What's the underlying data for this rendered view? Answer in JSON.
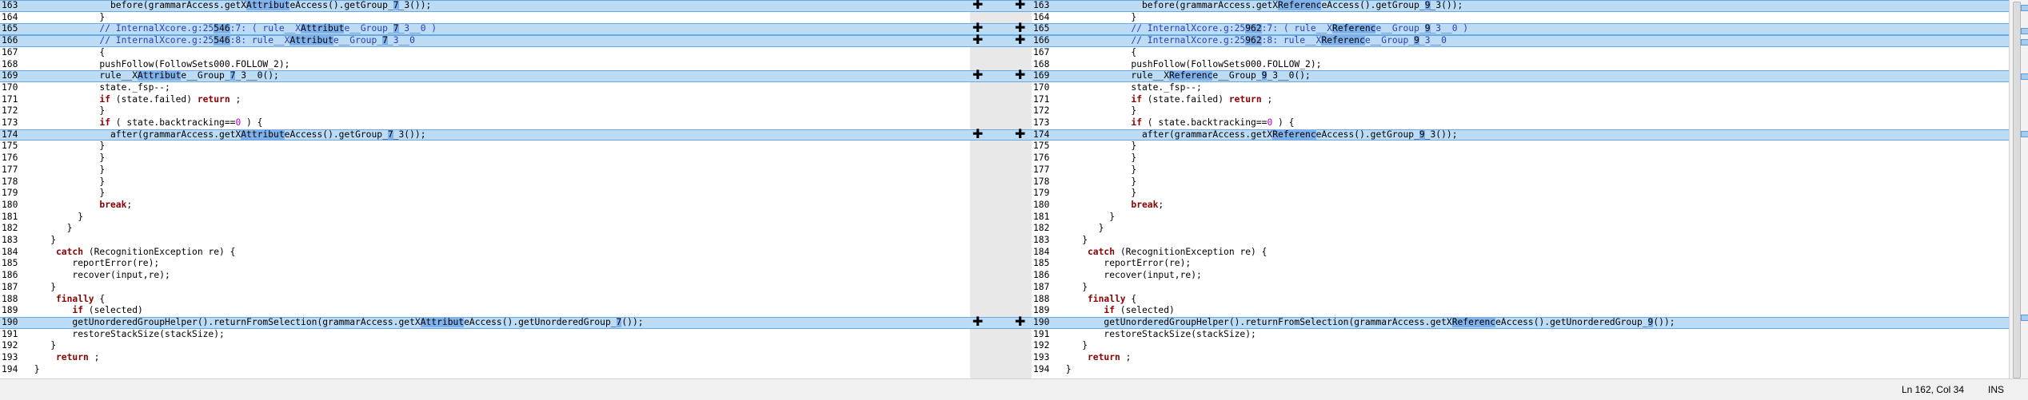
{
  "status_bar": {
    "position": "Ln 162, Col 34",
    "mode": "INS"
  },
  "left_pane": {
    "lines": [
      {
        "n": "163",
        "changed": true,
        "indent": 15,
        "segs": [
          [
            "p",
            "before(grammarAccess.getX"
          ],
          [
            "h",
            "Attribut"
          ],
          [
            "p",
            "eAccess().getGroup_"
          ],
          [
            "h",
            "7"
          ],
          [
            "p",
            "_3());"
          ]
        ]
      },
      {
        "n": "164",
        "changed": false,
        "indent": 13,
        "segs": [
          [
            "p",
            "}"
          ]
        ]
      },
      {
        "n": "165",
        "changed": true,
        "indent": 13,
        "segs": [
          [
            "c",
            "// InternalXcore.g:25"
          ],
          [
            "h",
            "546"
          ],
          [
            "c",
            ":7: ( rule__X"
          ],
          [
            "h",
            "Attribut"
          ],
          [
            "c",
            "e__Group_"
          ],
          [
            "h",
            "7"
          ],
          [
            "c",
            "_3__0 )"
          ]
        ]
      },
      {
        "n": "166",
        "changed": true,
        "indent": 13,
        "segs": [
          [
            "c",
            "// InternalXcore.g:25"
          ],
          [
            "h",
            "546"
          ],
          [
            "c",
            ":8: rule__X"
          ],
          [
            "h",
            "Attribut"
          ],
          [
            "c",
            "e__Group_"
          ],
          [
            "h",
            "7"
          ],
          [
            "c",
            "_3__0"
          ]
        ]
      },
      {
        "n": "167",
        "changed": false,
        "indent": 13,
        "segs": [
          [
            "p",
            "{"
          ]
        ]
      },
      {
        "n": "168",
        "changed": false,
        "indent": 13,
        "segs": [
          [
            "p",
            "pushFollow(FollowSets000.FOLLOW_2);"
          ]
        ]
      },
      {
        "n": "169",
        "changed": true,
        "indent": 13,
        "segs": [
          [
            "p",
            "rule__X"
          ],
          [
            "h",
            "Attribut"
          ],
          [
            "p",
            "e__Group_"
          ],
          [
            "h",
            "7"
          ],
          [
            "p",
            "_3__0();"
          ]
        ]
      },
      {
        "n": "170",
        "changed": false,
        "indent": 13,
        "segs": [
          [
            "p",
            "state._fsp--;"
          ]
        ]
      },
      {
        "n": "171",
        "changed": false,
        "indent": 13,
        "segs": [
          [
            "k",
            "if"
          ],
          [
            "p",
            " (state.failed) "
          ],
          [
            "k",
            "return"
          ],
          [
            "p",
            " ;"
          ]
        ]
      },
      {
        "n": "172",
        "changed": false,
        "indent": 13,
        "segs": [
          [
            "p",
            "}"
          ]
        ]
      },
      {
        "n": "173",
        "changed": false,
        "indent": 13,
        "segs": [
          [
            "k",
            "if"
          ],
          [
            "p",
            " ( state.backtracking=="
          ],
          [
            "n",
            "0"
          ],
          [
            "p",
            " ) {"
          ]
        ]
      },
      {
        "n": "174",
        "changed": true,
        "indent": 15,
        "segs": [
          [
            "p",
            "after(grammarAccess.getX"
          ],
          [
            "h",
            "Attribut"
          ],
          [
            "p",
            "eAccess().getGroup_"
          ],
          [
            "h",
            "7"
          ],
          [
            "p",
            "_3());"
          ]
        ]
      },
      {
        "n": "175",
        "changed": false,
        "indent": 13,
        "segs": [
          [
            "p",
            "}"
          ]
        ]
      },
      {
        "n": "176",
        "changed": false,
        "indent": 13,
        "segs": [
          [
            "p",
            "}"
          ]
        ]
      },
      {
        "n": "177",
        "changed": false,
        "indent": 13,
        "segs": [
          [
            "p",
            "}"
          ]
        ]
      },
      {
        "n": "178",
        "changed": false,
        "indent": 13,
        "segs": [
          [
            "p",
            "}"
          ]
        ]
      },
      {
        "n": "179",
        "changed": false,
        "indent": 13,
        "segs": [
          [
            "p",
            "}"
          ]
        ]
      },
      {
        "n": "180",
        "changed": false,
        "indent": 13,
        "segs": [
          [
            "k",
            "break"
          ],
          [
            "p",
            ";"
          ]
        ]
      },
      {
        "n": "181",
        "changed": false,
        "indent": 9,
        "segs": [
          [
            "p",
            "}"
          ]
        ]
      },
      {
        "n": "182",
        "changed": false,
        "indent": 7,
        "segs": [
          [
            "p",
            "}"
          ]
        ]
      },
      {
        "n": "183",
        "changed": false,
        "indent": 4,
        "segs": [
          [
            "p",
            "}"
          ]
        ]
      },
      {
        "n": "184",
        "changed": false,
        "indent": 5,
        "segs": [
          [
            "k",
            "catch"
          ],
          [
            "p",
            " (RecognitionException re) {"
          ]
        ]
      },
      {
        "n": "185",
        "changed": false,
        "indent": 8,
        "segs": [
          [
            "p",
            "reportError(re);"
          ]
        ]
      },
      {
        "n": "186",
        "changed": false,
        "indent": 8,
        "segs": [
          [
            "p",
            "recover(input,re);"
          ]
        ]
      },
      {
        "n": "187",
        "changed": false,
        "indent": 4,
        "segs": [
          [
            "p",
            "}"
          ]
        ]
      },
      {
        "n": "188",
        "changed": false,
        "indent": 5,
        "segs": [
          [
            "k",
            "finally"
          ],
          [
            "p",
            " {"
          ]
        ]
      },
      {
        "n": "189",
        "changed": false,
        "indent": 8,
        "segs": [
          [
            "k",
            "if"
          ],
          [
            "p",
            " (selected)"
          ]
        ]
      },
      {
        "n": "190",
        "changed": true,
        "indent": 8,
        "segs": [
          [
            "p",
            "getUnorderedGroupHelper().returnFromSelection(grammarAccess.getX"
          ],
          [
            "h",
            "Attribut"
          ],
          [
            "p",
            "eAccess().getUnorderedGroup_"
          ],
          [
            "h",
            "7"
          ],
          [
            "p",
            "());"
          ]
        ]
      },
      {
        "n": "191",
        "changed": false,
        "indent": 8,
        "segs": [
          [
            "p",
            "restoreStackSize(stackSize);"
          ]
        ]
      },
      {
        "n": "192",
        "changed": false,
        "indent": 4,
        "segs": [
          [
            "p",
            "}"
          ]
        ]
      },
      {
        "n": "193",
        "changed": false,
        "indent": 5,
        "segs": [
          [
            "k",
            "return"
          ],
          [
            "p",
            " ;"
          ]
        ]
      },
      {
        "n": "194",
        "changed": false,
        "indent": 1,
        "segs": [
          [
            "p",
            "}"
          ]
        ]
      }
    ]
  },
  "right_pane": {
    "lines": [
      {
        "n": "163",
        "changed": true,
        "indent": 15,
        "segs": [
          [
            "p",
            "before(grammarAccess.getX"
          ],
          [
            "h",
            "Referenc"
          ],
          [
            "p",
            "eAccess().getGroup_"
          ],
          [
            "h",
            "9"
          ],
          [
            "p",
            "_3());"
          ]
        ]
      },
      {
        "n": "164",
        "changed": false,
        "indent": 13,
        "segs": [
          [
            "p",
            "}"
          ]
        ]
      },
      {
        "n": "165",
        "changed": true,
        "indent": 13,
        "segs": [
          [
            "c",
            "// InternalXcore.g:25"
          ],
          [
            "h",
            "962"
          ],
          [
            "c",
            ":7: ( rule__X"
          ],
          [
            "h",
            "Referenc"
          ],
          [
            "c",
            "e__Group_"
          ],
          [
            "h",
            "9"
          ],
          [
            "c",
            "_3__0 )"
          ]
        ]
      },
      {
        "n": "166",
        "changed": true,
        "indent": 13,
        "segs": [
          [
            "c",
            "// InternalXcore.g:25"
          ],
          [
            "h",
            "962"
          ],
          [
            "c",
            ":8: rule__X"
          ],
          [
            "h",
            "Referenc"
          ],
          [
            "c",
            "e__Group_"
          ],
          [
            "h",
            "9"
          ],
          [
            "c",
            "_3__0"
          ]
        ]
      },
      {
        "n": "167",
        "changed": false,
        "indent": 13,
        "segs": [
          [
            "p",
            "{"
          ]
        ]
      },
      {
        "n": "168",
        "changed": false,
        "indent": 13,
        "segs": [
          [
            "p",
            "pushFollow(FollowSets000.FOLLOW_2);"
          ]
        ]
      },
      {
        "n": "169",
        "changed": true,
        "indent": 13,
        "segs": [
          [
            "p",
            "rule__X"
          ],
          [
            "h",
            "Referenc"
          ],
          [
            "p",
            "e__Group_"
          ],
          [
            "h",
            "9"
          ],
          [
            "p",
            "_3__0();"
          ]
        ]
      },
      {
        "n": "170",
        "changed": false,
        "indent": 13,
        "segs": [
          [
            "p",
            "state._fsp--;"
          ]
        ]
      },
      {
        "n": "171",
        "changed": false,
        "indent": 13,
        "segs": [
          [
            "k",
            "if"
          ],
          [
            "p",
            " (state.failed) "
          ],
          [
            "k",
            "return"
          ],
          [
            "p",
            " ;"
          ]
        ]
      },
      {
        "n": "172",
        "changed": false,
        "indent": 13,
        "segs": [
          [
            "p",
            "}"
          ]
        ]
      },
      {
        "n": "173",
        "changed": false,
        "indent": 13,
        "segs": [
          [
            "k",
            "if"
          ],
          [
            "p",
            " ( state.backtracking=="
          ],
          [
            "n",
            "0"
          ],
          [
            "p",
            " ) {"
          ]
        ]
      },
      {
        "n": "174",
        "changed": true,
        "indent": 15,
        "segs": [
          [
            "p",
            "after(grammarAccess.getX"
          ],
          [
            "h",
            "Referenc"
          ],
          [
            "p",
            "eAccess().getGroup_"
          ],
          [
            "h",
            "9"
          ],
          [
            "p",
            "_3());"
          ]
        ]
      },
      {
        "n": "175",
        "changed": false,
        "indent": 13,
        "segs": [
          [
            "p",
            "}"
          ]
        ]
      },
      {
        "n": "176",
        "changed": false,
        "indent": 13,
        "segs": [
          [
            "p",
            "}"
          ]
        ]
      },
      {
        "n": "177",
        "changed": false,
        "indent": 13,
        "segs": [
          [
            "p",
            "}"
          ]
        ]
      },
      {
        "n": "178",
        "changed": false,
        "indent": 13,
        "segs": [
          [
            "p",
            "}"
          ]
        ]
      },
      {
        "n": "179",
        "changed": false,
        "indent": 13,
        "segs": [
          [
            "p",
            "}"
          ]
        ]
      },
      {
        "n": "180",
        "changed": false,
        "indent": 13,
        "segs": [
          [
            "k",
            "break"
          ],
          [
            "p",
            ";"
          ]
        ]
      },
      {
        "n": "181",
        "changed": false,
        "indent": 9,
        "segs": [
          [
            "p",
            "}"
          ]
        ]
      },
      {
        "n": "182",
        "changed": false,
        "indent": 7,
        "segs": [
          [
            "p",
            "}"
          ]
        ]
      },
      {
        "n": "183",
        "changed": false,
        "indent": 4,
        "segs": [
          [
            "p",
            "}"
          ]
        ]
      },
      {
        "n": "184",
        "changed": false,
        "indent": 5,
        "segs": [
          [
            "k",
            "catch"
          ],
          [
            "p",
            " (RecognitionException re) {"
          ]
        ]
      },
      {
        "n": "185",
        "changed": false,
        "indent": 8,
        "segs": [
          [
            "p",
            "reportError(re);"
          ]
        ]
      },
      {
        "n": "186",
        "changed": false,
        "indent": 8,
        "segs": [
          [
            "p",
            "recover(input,re);"
          ]
        ]
      },
      {
        "n": "187",
        "changed": false,
        "indent": 4,
        "segs": [
          [
            "p",
            "}"
          ]
        ]
      },
      {
        "n": "188",
        "changed": false,
        "indent": 5,
        "segs": [
          [
            "k",
            "finally"
          ],
          [
            "p",
            " {"
          ]
        ]
      },
      {
        "n": "189",
        "changed": false,
        "indent": 8,
        "segs": [
          [
            "k",
            "if"
          ],
          [
            "p",
            " (selected)"
          ]
        ]
      },
      {
        "n": "190",
        "changed": true,
        "indent": 8,
        "segs": [
          [
            "p",
            "getUnorderedGroupHelper().returnFromSelection(grammarAccess.getX"
          ],
          [
            "h",
            "Referenc"
          ],
          [
            "p",
            "eAccess().getUnorderedGroup_"
          ],
          [
            "h",
            "9"
          ],
          [
            "p",
            "());"
          ]
        ]
      },
      {
        "n": "191",
        "changed": false,
        "indent": 8,
        "segs": [
          [
            "p",
            "restoreStackSize(stackSize);"
          ]
        ]
      },
      {
        "n": "192",
        "changed": false,
        "indent": 4,
        "segs": [
          [
            "p",
            "}"
          ]
        ]
      },
      {
        "n": "193",
        "changed": false,
        "indent": 5,
        "segs": [
          [
            "k",
            "return"
          ],
          [
            "p",
            " ;"
          ]
        ]
      },
      {
        "n": "194",
        "changed": false,
        "indent": 1,
        "segs": [
          [
            "p",
            "}"
          ]
        ]
      }
    ]
  },
  "gutter": {
    "merge_icon": "plus-merge-icon"
  },
  "colors": {
    "changed_bg": "#bcdcf6",
    "changed_border": "#6aa7e3",
    "highlight": "#7fb2ec",
    "keyword": "#8b0000",
    "comment": "#2a40b0",
    "number": "#c000c0"
  }
}
